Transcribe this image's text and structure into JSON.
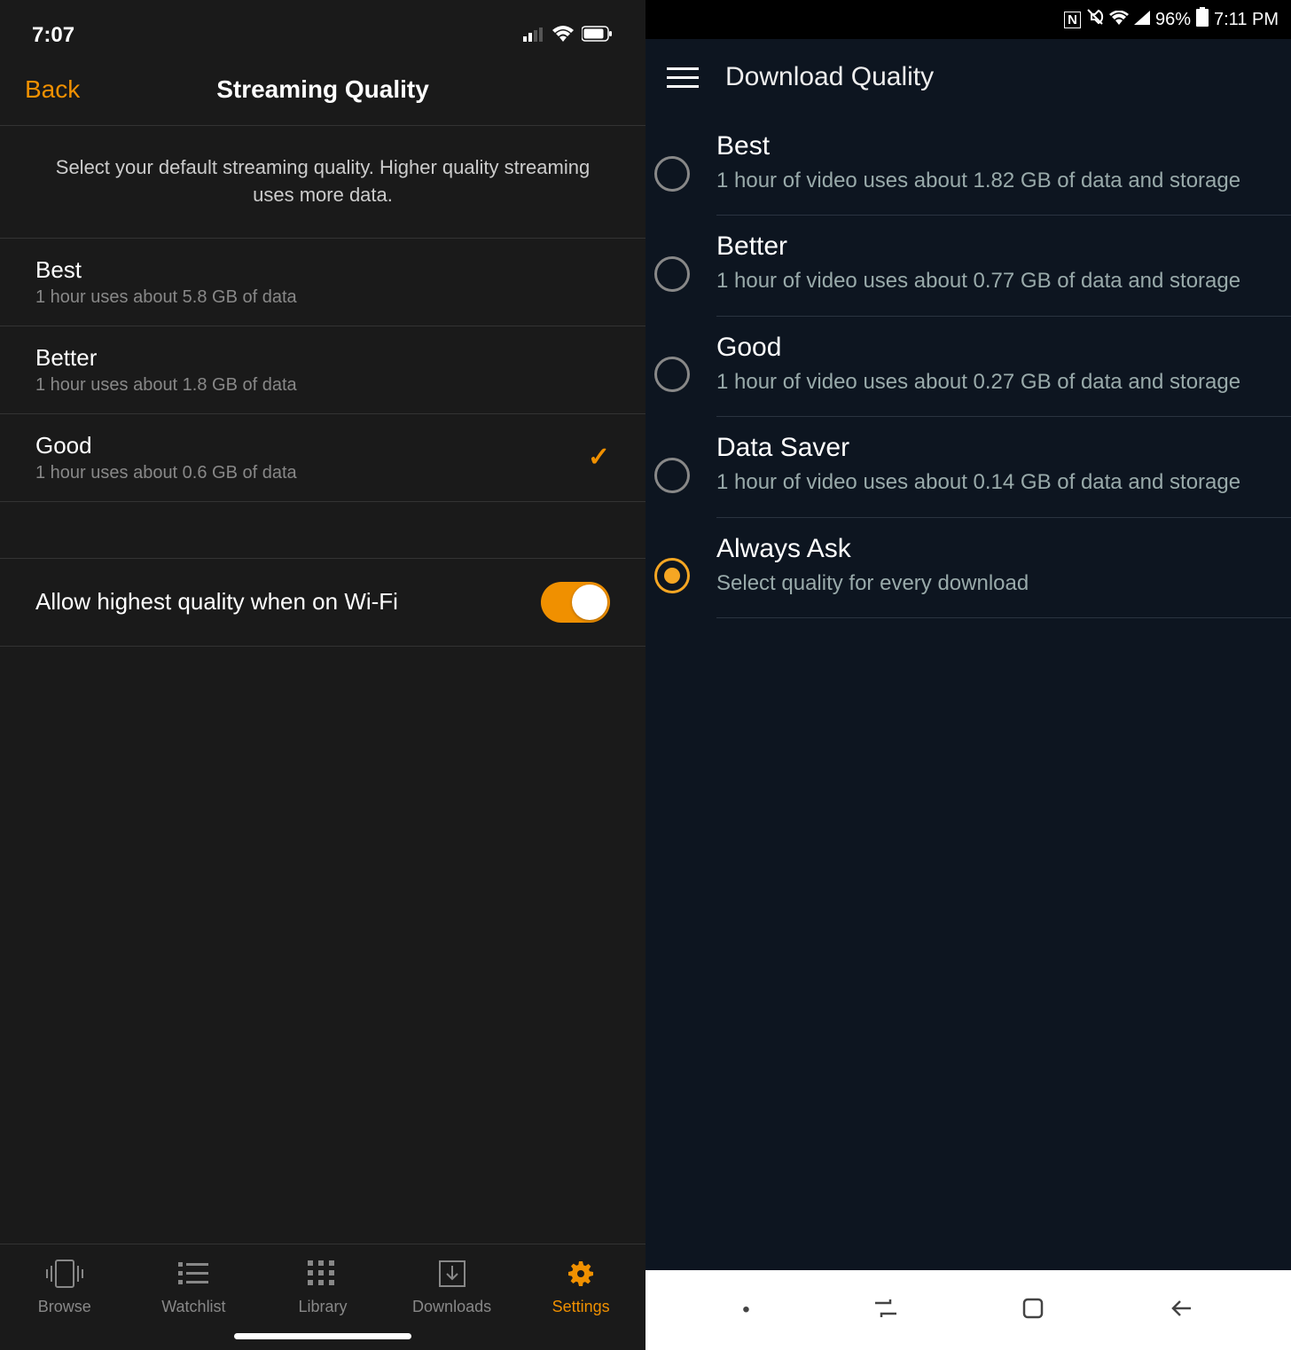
{
  "left": {
    "statusbar": {
      "time": "7:07"
    },
    "nav": {
      "back": "Back",
      "title": "Streaming Quality"
    },
    "description": "Select your default streaming quality. Higher quality streaming uses more data.",
    "options": [
      {
        "label": "Best",
        "sub": "1 hour uses about 5.8 GB of data",
        "selected": false
      },
      {
        "label": "Better",
        "sub": "1 hour uses about 1.8 GB of data",
        "selected": false
      },
      {
        "label": "Good",
        "sub": "1 hour uses about 0.6 GB of data",
        "selected": true
      }
    ],
    "toggle": {
      "label": "Allow highest quality when on Wi-Fi",
      "on": true
    },
    "tabs": [
      {
        "label": "Browse"
      },
      {
        "label": "Watchlist"
      },
      {
        "label": "Library"
      },
      {
        "label": "Downloads"
      },
      {
        "label": "Settings"
      }
    ]
  },
  "right": {
    "statusbar": {
      "battery": "96%",
      "time": "7:11 PM"
    },
    "title": "Download Quality",
    "options": [
      {
        "label": "Best",
        "sub": "1 hour of video uses about 1.82 GB of data and storage",
        "selected": false
      },
      {
        "label": "Better",
        "sub": "1 hour of video uses about 0.77 GB of data and storage",
        "selected": false
      },
      {
        "label": "Good",
        "sub": "1 hour of video uses about 0.27 GB of data and storage",
        "selected": false
      },
      {
        "label": "Data Saver",
        "sub": "1 hour of video uses about 0.14 GB of data and storage",
        "selected": false
      },
      {
        "label": "Always Ask",
        "sub": "Select quality for every download",
        "selected": true
      }
    ]
  }
}
